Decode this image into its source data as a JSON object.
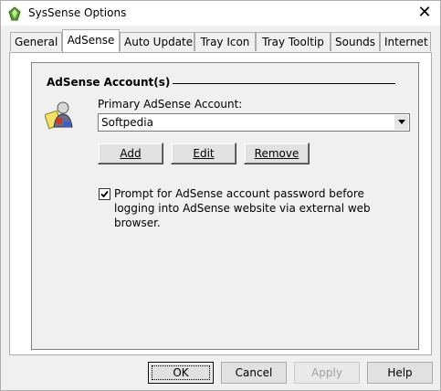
{
  "window": {
    "title": "SysSense Options",
    "close_glyph": "✕"
  },
  "tabs": [
    {
      "label": "General",
      "active": false
    },
    {
      "label": "AdSense",
      "active": true
    },
    {
      "label": "Auto Update",
      "active": false
    },
    {
      "label": "Tray Icon",
      "active": false
    },
    {
      "label": "Tray Tooltip",
      "active": false
    },
    {
      "label": "Sounds",
      "active": false
    },
    {
      "label": "Internet",
      "active": false
    }
  ],
  "adsense": {
    "group_title": "AdSense Account(s)",
    "primary_label": "Primary AdSense Account:",
    "primary_value": "Softpedia",
    "buttons": {
      "add": "Add",
      "edit": "Edit",
      "remove": "Remove"
    },
    "prompt_checkbox": {
      "checked": true,
      "label": "Prompt for AdSense account password before logging into AdSense website via external web browser."
    },
    "icons": {
      "account": "user-card-icon"
    }
  },
  "footer": {
    "ok": "OK",
    "cancel": "Cancel",
    "apply": "Apply",
    "help": "Help"
  }
}
